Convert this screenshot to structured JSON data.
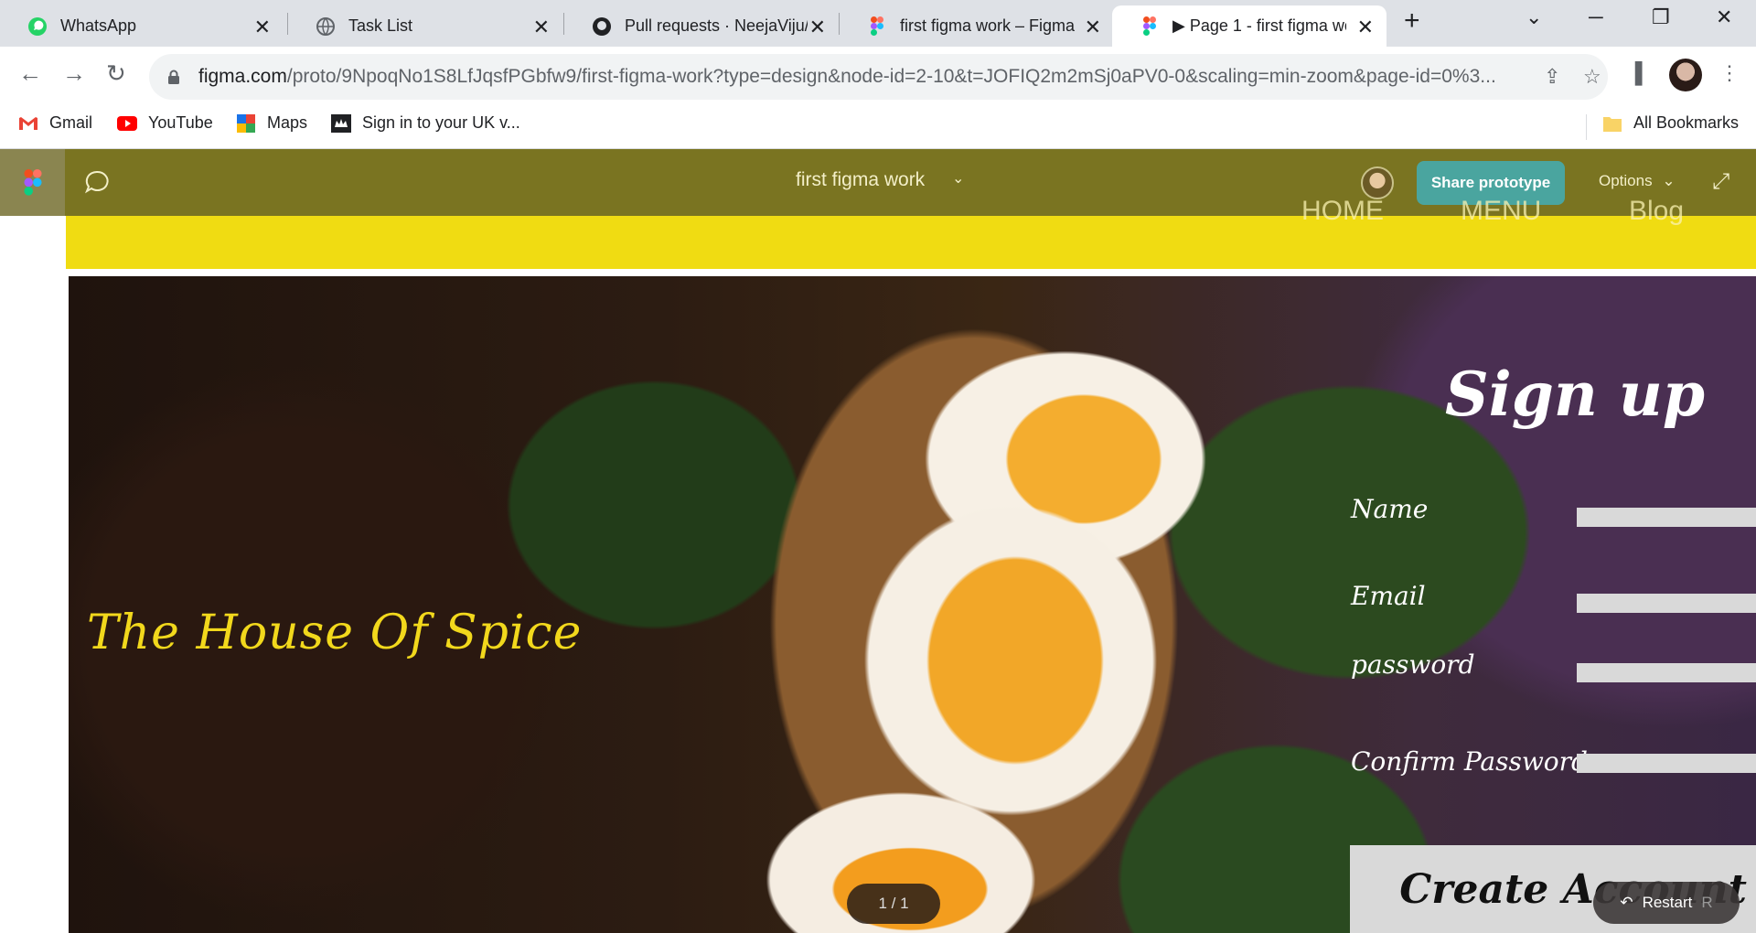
{
  "browser": {
    "tabs": [
      {
        "title": "WhatsApp",
        "icon": "whatsapp-icon"
      },
      {
        "title": "Task List",
        "icon": "globe-icon"
      },
      {
        "title": "Pull requests · NeejaViju/",
        "icon": "github-icon"
      },
      {
        "title": "first figma work – Figma",
        "icon": "figma-icon"
      },
      {
        "title": "▶ Page 1 - first figma wo",
        "icon": "figma-icon",
        "active": true
      }
    ],
    "url_host": "figma.com",
    "url_path": "/proto/9NpoqNo1S8LfJqsfPGbfw9/first-figma-work?type=design&node-id=2-10&t=JOFIQ2m2mSj0aPV0-0&scaling=min-zoom&page-id=0%3...",
    "bookmarks": [
      {
        "label": "Gmail",
        "icon": "gmail-icon"
      },
      {
        "label": "YouTube",
        "icon": "youtube-icon"
      },
      {
        "label": "Maps",
        "icon": "maps-icon"
      },
      {
        "label": "Sign in to your UK v...",
        "icon": "crown-icon"
      }
    ],
    "all_bookmarks": "All Bookmarks"
  },
  "figma": {
    "file_title": "first figma work",
    "share_label": "Share prototype",
    "options_label": "Options",
    "pager": "1 / 1",
    "restart_label": "Restart",
    "restart_hint": "R"
  },
  "site": {
    "nav": [
      "HOME",
      "MENU",
      "Blog"
    ],
    "hero_title": "The House Of Spice",
    "signup_title": "Sign up",
    "fields": [
      {
        "label": "Name"
      },
      {
        "label": "Email"
      },
      {
        "label": "password"
      },
      {
        "label": "Confirm Password"
      }
    ],
    "create_account": "Create Account"
  },
  "colors": {
    "figma_bar": "#7a7421",
    "share_button": "#4aa59f",
    "yellow_nav": "#f0dc12",
    "hero_title": "#f2d81c"
  }
}
